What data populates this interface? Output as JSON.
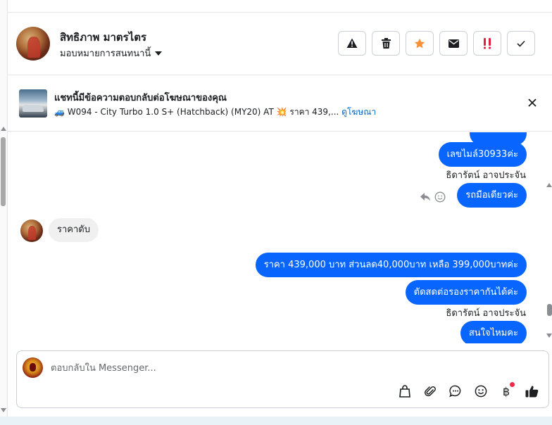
{
  "header": {
    "contact_name": "สิทธิภาพ มาตรไตร",
    "assign_label": "มอบหมายการสนทนานี้",
    "actions": [
      {
        "name": "report-button",
        "icon": "warning-triangle-icon"
      },
      {
        "name": "delete-button",
        "icon": "trash-icon"
      },
      {
        "name": "star-button",
        "icon": "star-icon",
        "color": "#f7923a"
      },
      {
        "name": "mark-unread-button",
        "icon": "envelope-icon"
      },
      {
        "name": "priority-button",
        "icon": "exclamation-icon",
        "color": "#e41e3f"
      },
      {
        "name": "done-button",
        "icon": "checkmark-icon"
      }
    ]
  },
  "ad_banner": {
    "title": "แชทนี้มีข้อความตอบกลับต่อโฆษณาของคุณ",
    "desc_car_emoji": "🚙",
    "desc_text": "W094 - City Turbo 1.0 S+ (Hatchback) (MY20) AT",
    "desc_burst_emoji": "💥",
    "desc_price": "ราคา 439,...",
    "link_label": "ดูโฆษณา"
  },
  "messages": {
    "out_1": "เลขไมล์30933ค่ะ",
    "sender_1": "ธิดารัตน์ อาจประจัน",
    "out_2": "รถมือเดียวค่ะ",
    "in_1": "ราคาดับ",
    "out_3": "ราคา 439,000 บาท ส่วนลด40,000บาท เหลือ 399,000บาทค่ะ",
    "out_4": "ตัดสดต่อรองราคากันได้ค่ะ",
    "sender_2": "ธิดารัตน์ อาจประจัน",
    "out_5": "สนใจไหมคะ"
  },
  "composer": {
    "placeholder": "ตอบกลับใน Messenger...",
    "baht_symbol": "฿",
    "notification_color": "#f02849"
  },
  "colors": {
    "accent_blue": "#0866ff",
    "link_blue": "#0a66c2",
    "incoming_bubble": "#f0f0f0"
  }
}
